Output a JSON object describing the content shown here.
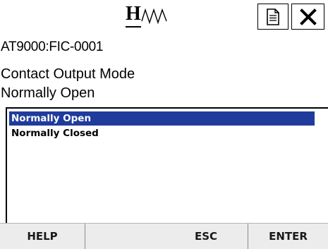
{
  "header": {
    "logo_letter": "H",
    "doc_icon": "document-icon",
    "close_icon": "close-icon"
  },
  "device": {
    "tag": "AT9000:FIC-0001"
  },
  "parameter": {
    "label": "Contact Output Mode",
    "current_value": "Normally Open"
  },
  "options": {
    "items": [
      {
        "label": "Normally Open",
        "selected": true
      },
      {
        "label": "Normally Closed",
        "selected": false
      }
    ]
  },
  "toolbar": {
    "help_label": "HELP",
    "blank_label": "",
    "esc_label": "ESC",
    "enter_label": "ENTER"
  },
  "colors": {
    "selection": "#1f3c9c",
    "toolbar_bg": "#ececec"
  }
}
